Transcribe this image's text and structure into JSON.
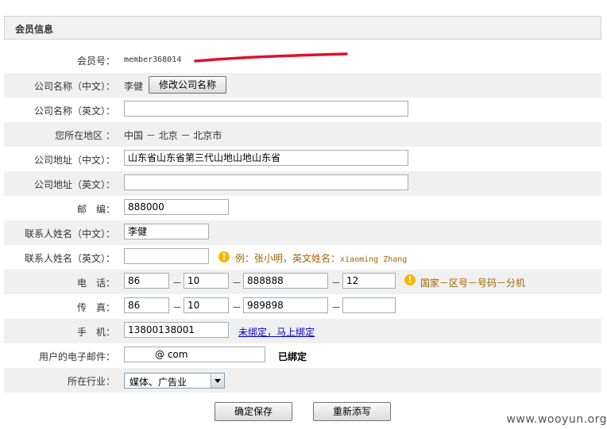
{
  "panel": {
    "title": "会员信息"
  },
  "member": {
    "label": "会员号：",
    "value": "member368014"
  },
  "company_cn": {
    "label": "公司名称（中文）：",
    "value": "李健",
    "button": "修改公司名称"
  },
  "company_en": {
    "label": "公司名称（英文）：",
    "value": ""
  },
  "region": {
    "label": "您所在地区 ：",
    "value": "中国 － 北京 － 北京市"
  },
  "address_cn": {
    "label": "公司地址（中文）：",
    "value": "山东省山东省第三代山地山地山东省"
  },
  "address_en": {
    "label": "公司地址（英文）：",
    "value": ""
  },
  "postcode": {
    "label": "邮　编：",
    "value": "888000"
  },
  "contact_cn": {
    "label": "联系人姓名（中文）：",
    "value": "李健"
  },
  "contact_en": {
    "label": "联系人姓名（英文）：",
    "value": "",
    "hint_prefix": "例：张小明，英文姓名：",
    "hint_example": "xiaoming Zhang"
  },
  "phone": {
    "label": "电　话：",
    "country": "86",
    "area": "10",
    "number": "888888",
    "ext": "12",
    "sep": "－",
    "hint": "国家－区号－号码－分机"
  },
  "fax": {
    "label": "传　真：",
    "country": "86",
    "area": "10",
    "number": "989898",
    "ext": "",
    "sep": "－"
  },
  "mobile": {
    "label": "手　机：",
    "value": "13800138001",
    "link": "未绑定，马上绑定"
  },
  "email": {
    "label": "用户的电子邮件：",
    "value": "@            com",
    "status": "已绑定"
  },
  "industry": {
    "label": "所在行业：",
    "selected": "媒体、广告业"
  },
  "actions": {
    "save": "确定保存",
    "reset": "重新添写"
  },
  "watermark": "www.wooyun.org",
  "colors": {
    "alt_row": "#f0f0f0",
    "hint": "#a06400",
    "warn": "#f5b800",
    "link": "#0000cc",
    "redmark": "#e0102a"
  }
}
